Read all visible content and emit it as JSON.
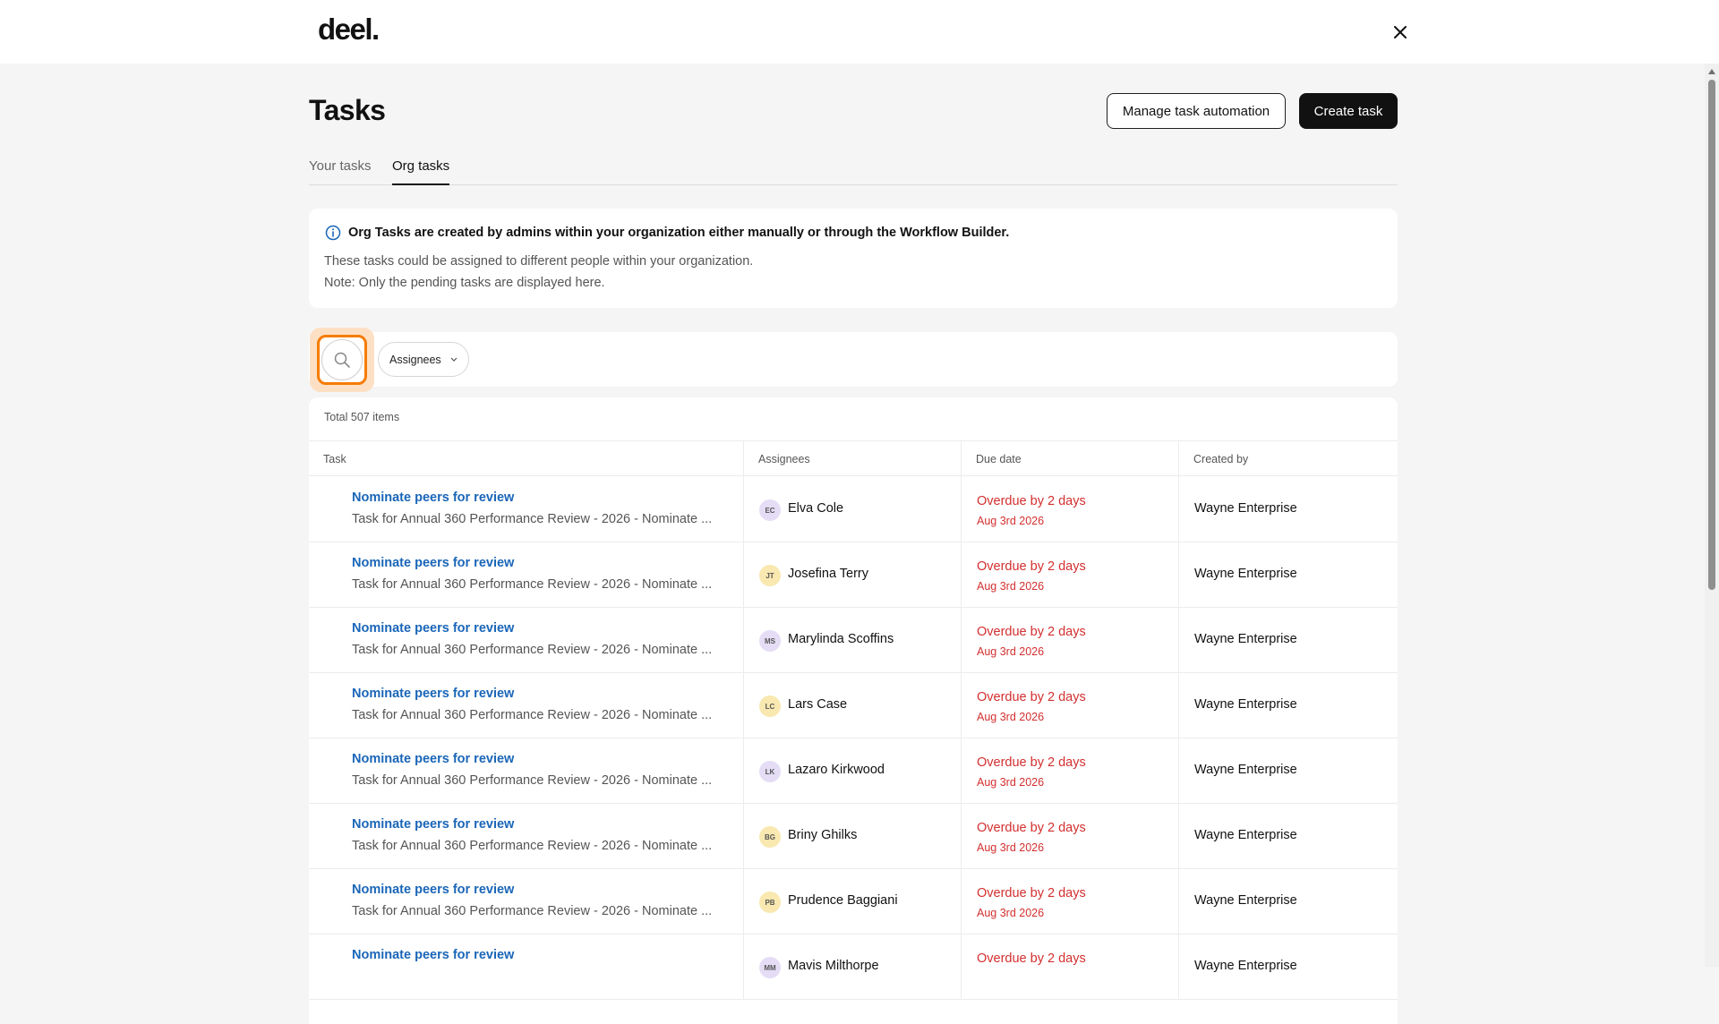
{
  "brand": {
    "logo": "deel."
  },
  "header": {
    "title": "Tasks",
    "manage_automation_label": "Manage task automation",
    "create_task_label": "Create task"
  },
  "tabs": [
    {
      "label": "Your tasks",
      "active": false
    },
    {
      "label": "Org tasks",
      "active": true
    }
  ],
  "info": {
    "title": "Org Tasks are created by admins within your organization either manually or through the Workflow Builder.",
    "line1": "These tasks could be assigned to different people within your organization.",
    "line2": "Note: Only the pending tasks are displayed here."
  },
  "filters": {
    "assignees_label": "Assignees"
  },
  "table": {
    "total_label": "Total 507 items",
    "columns": [
      "Task",
      "Assignees",
      "Due date",
      "Created by"
    ],
    "rows": [
      {
        "task": "Nominate peers for review",
        "desc": "Task for Annual 360 Performance Review - 2026 - Nominate ...",
        "initials": "EC",
        "assignee": "Elva Cole",
        "avatar_color": "#e4ddf5",
        "due_status": "Overdue by 2 days",
        "due_date": "Aug 3rd 2026",
        "creator": "Wayne Enterprise"
      },
      {
        "task": "Nominate peers for review",
        "desc": "Task for Annual 360 Performance Review - 2026 - Nominate ...",
        "initials": "JT",
        "assignee": "Josefina Terry",
        "avatar_color": "#f9e8b0",
        "due_status": "Overdue by 2 days",
        "due_date": "Aug 3rd 2026",
        "creator": "Wayne Enterprise"
      },
      {
        "task": "Nominate peers for review",
        "desc": "Task for Annual 360 Performance Review - 2026 - Nominate ...",
        "initials": "MS",
        "assignee": "Marylinda Scoffins",
        "avatar_color": "#e4ddf5",
        "due_status": "Overdue by 2 days",
        "due_date": "Aug 3rd 2026",
        "creator": "Wayne Enterprise"
      },
      {
        "task": "Nominate peers for review",
        "desc": "Task for Annual 360 Performance Review - 2026 - Nominate ...",
        "initials": "LC",
        "assignee": "Lars Case",
        "avatar_color": "#f9e8b0",
        "due_status": "Overdue by 2 days",
        "due_date": "Aug 3rd 2026",
        "creator": "Wayne Enterprise"
      },
      {
        "task": "Nominate peers for review",
        "desc": "Task for Annual 360 Performance Review - 2026 - Nominate ...",
        "initials": "LK",
        "assignee": "Lazaro Kirkwood",
        "avatar_color": "#e4ddf5",
        "due_status": "Overdue by 2 days",
        "due_date": "Aug 3rd 2026",
        "creator": "Wayne Enterprise"
      },
      {
        "task": "Nominate peers for review",
        "desc": "Task for Annual 360 Performance Review - 2026 - Nominate ...",
        "initials": "BG",
        "assignee": "Briny Ghilks",
        "avatar_color": "#f9e8b0",
        "due_status": "Overdue by 2 days",
        "due_date": "Aug 3rd 2026",
        "creator": "Wayne Enterprise"
      },
      {
        "task": "Nominate peers for review",
        "desc": "Task for Annual 360 Performance Review - 2026 - Nominate ...",
        "initials": "PB",
        "assignee": "Prudence Baggiani",
        "avatar_color": "#f9e8b0",
        "due_status": "Overdue by 2 days",
        "due_date": "Aug 3rd 2026",
        "creator": "Wayne Enterprise"
      },
      {
        "task": "Nominate peers for review",
        "desc": "",
        "initials": "MM",
        "assignee": "Mavis Milthorpe",
        "avatar_color": "#e4ddf5",
        "due_status": "Overdue by 2 days",
        "due_date": "",
        "creator": "Wayne Enterprise"
      }
    ]
  }
}
